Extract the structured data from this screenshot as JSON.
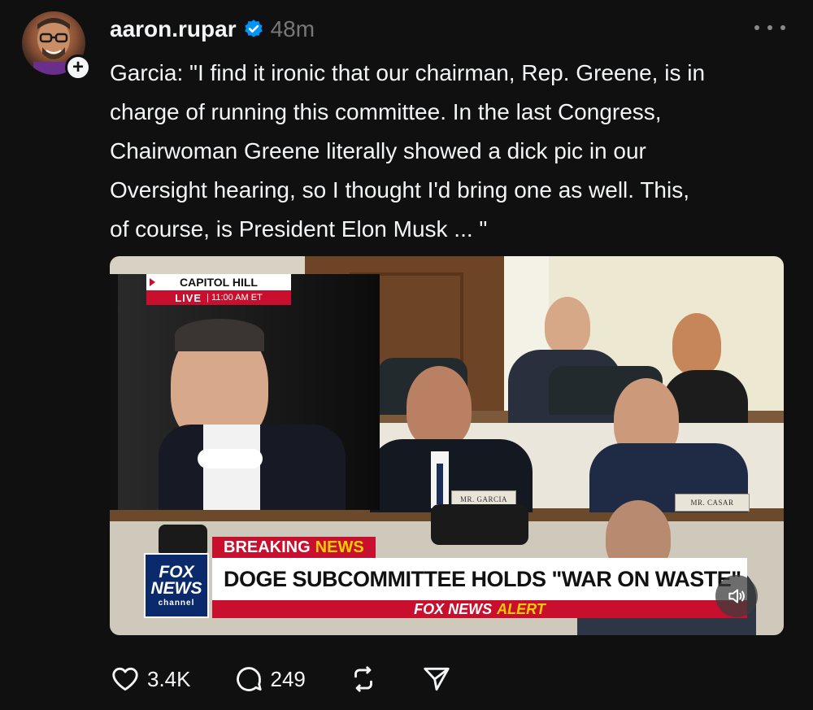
{
  "post": {
    "author": "aaron.rupar",
    "verified_icon": "verified-badge-icon",
    "time_ago": "48m",
    "text": "Garcia: \"I find it ironic that our chairman, Rep. Greene, is in\ncharge of running this committee. In the last Congress,\nChairwoman Greene literally showed a dick pic in our\nOversight hearing, so I thought I'd bring one as well. This,\nof course, is President Elon Musk ... \""
  },
  "media": {
    "location_top": "CAPITOL HILL",
    "location_live": "LIVE",
    "location_time": "| 11:00 AM ET",
    "nameplate_left": "MR. GARCIA",
    "nameplate_right": "MR. CASAR",
    "logo_line1": "FOX",
    "logo_line2": "NEWS",
    "logo_line3": "channel",
    "breaking_label": "BREAKING",
    "breaking_news": "NEWS",
    "headline": "DOGE SUBCOMMITTEE HOLDS \"WAR ON WASTE\" HEARING",
    "alert_prefix": "FOX NEWS",
    "alert_word": "ALERT"
  },
  "actions": {
    "likes": "3.4K",
    "replies": "249"
  },
  "colors": {
    "background": "#101010",
    "text": "#f3f5f7",
    "muted": "#777777",
    "verified": "#0095f6",
    "fox_red": "#c8102e",
    "fox_yellow": "#ffcc00"
  }
}
